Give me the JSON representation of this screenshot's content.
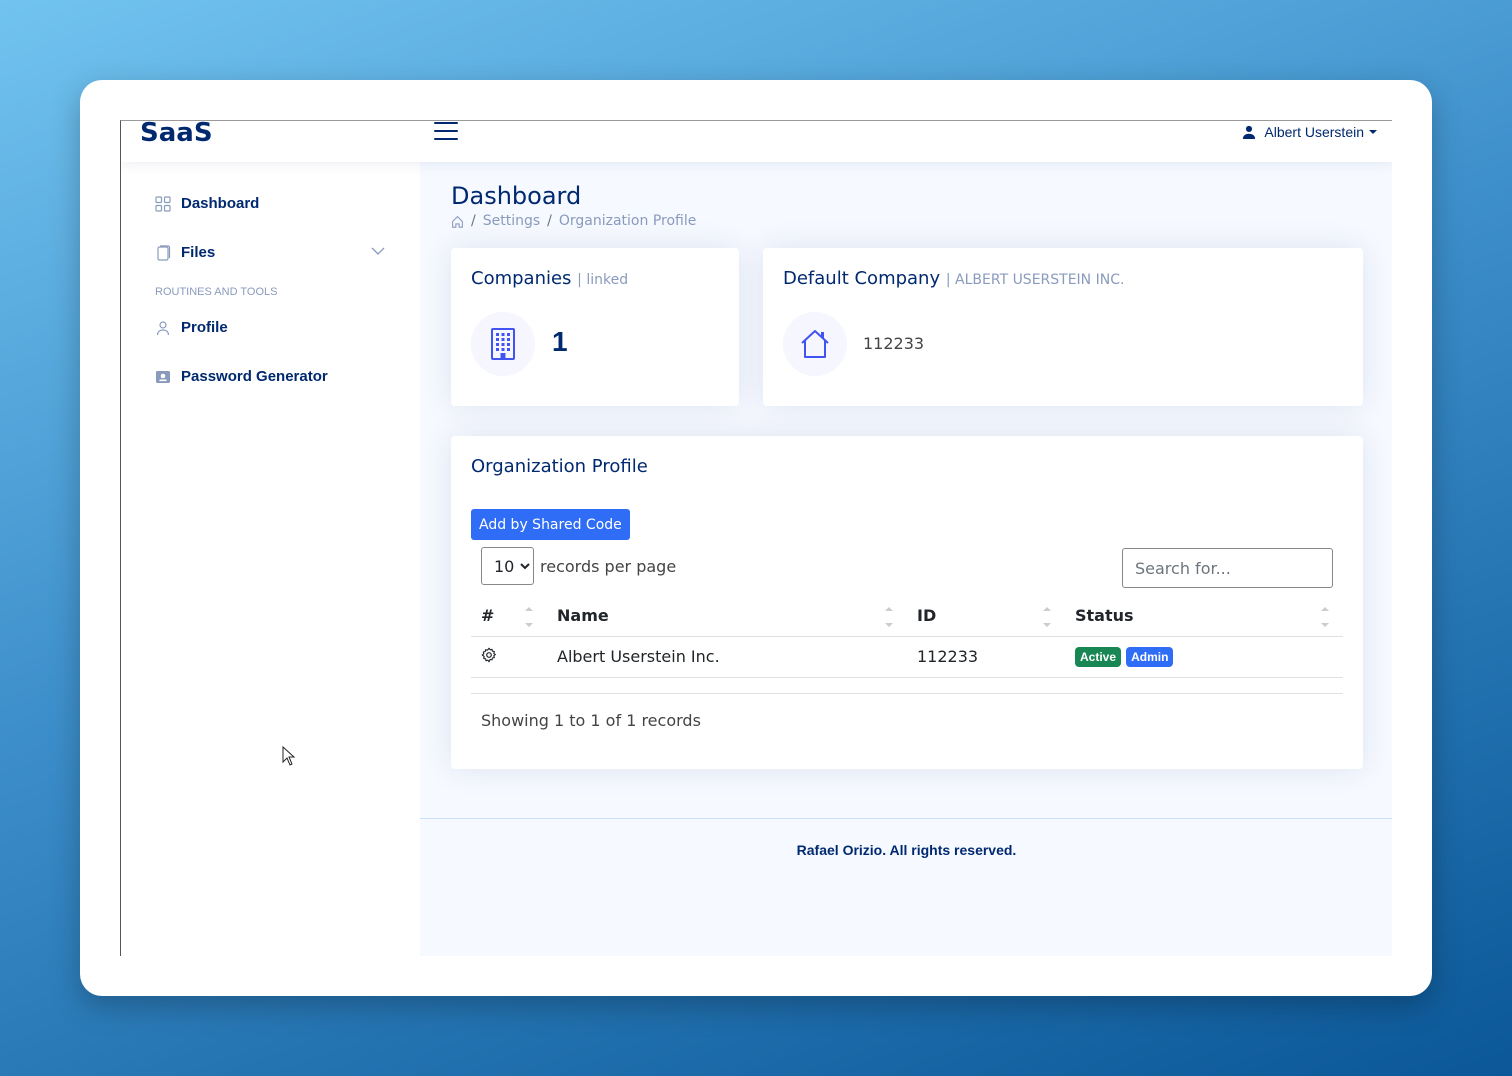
{
  "app": {
    "logo": "SaaS"
  },
  "header": {
    "user_name": "Albert Userstein"
  },
  "sidebar": {
    "items": [
      {
        "label": "Dashboard",
        "icon": "grid-icon"
      },
      {
        "label": "Files",
        "icon": "file-icon"
      },
      {
        "label": "Profile",
        "icon": "person-icon"
      },
      {
        "label": "Password Generator",
        "icon": "key-card-icon"
      }
    ],
    "section_heading": "ROUTINES AND TOOLS"
  },
  "page": {
    "title": "Dashboard",
    "breadcrumbs": [
      "Settings",
      "Organization Profile"
    ]
  },
  "cards": {
    "companies": {
      "title": "Companies",
      "subtitle": "| linked",
      "count": "1",
      "icon": "building-icon"
    },
    "default_company": {
      "title": "Default Company",
      "subtitle": "| ALBERT USERSTEIN INC.",
      "id": "112233",
      "icon": "house-icon"
    }
  },
  "org_profile": {
    "title": "Organization Profile",
    "add_button": "Add by Shared Code",
    "per_page_value": "10",
    "per_page_label": "records per page",
    "search_placeholder": "Search for...",
    "columns": [
      "#",
      "Name",
      "ID",
      "Status"
    ],
    "rows": [
      {
        "name": "Albert Userstein Inc.",
        "id": "112233",
        "badges": [
          "Active",
          "Admin"
        ]
      }
    ],
    "showing": "Showing 1 to 1 of 1 records"
  },
  "footer": {
    "text": "Rafael Orizio. All rights reserved."
  },
  "colors": {
    "brand": "#012970",
    "primary": "#2f6df6",
    "success": "#198754",
    "muted": "#899bbd",
    "main_bg": "#f6f9ff"
  }
}
